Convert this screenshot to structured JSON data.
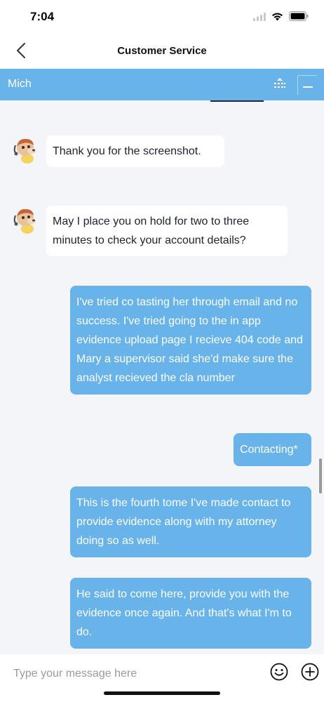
{
  "status_bar": {
    "time": "7:04"
  },
  "nav": {
    "title": "Customer Service"
  },
  "agent_bar": {
    "name": "Mich"
  },
  "messages": [
    {
      "from": "agent",
      "text": "Thank you for the screenshot."
    },
    {
      "from": "agent",
      "text": "May I place you on hold for  two to three minutes to check your account details?"
    },
    {
      "from": "user",
      "text": "I've tried co tasting her through email and no success. I've tried going to the in app evidence upload page I recieve 404 code and Mary a supervisor said she'd make sure the analyst recieved the cla number"
    },
    {
      "from": "user",
      "text": "Contacting*"
    },
    {
      "from": "user",
      "text": "This is the fourth tome I've made contact to provide evidence along with my attorney doing so as well."
    },
    {
      "from": "user",
      "text": "He said to come here, provide you with the evidence once again. And that's what I'm to do."
    }
  ],
  "composer": {
    "placeholder": "Type your message here"
  },
  "colors": {
    "accent": "#67b3ea",
    "background": "#f4f5f9",
    "bubble_in": "#ffffff"
  },
  "icons": [
    "wifi-icon",
    "battery-icon",
    "back-chevron-icon",
    "queue-icon",
    "minimize-icon",
    "emoji-icon",
    "add-icon"
  ]
}
